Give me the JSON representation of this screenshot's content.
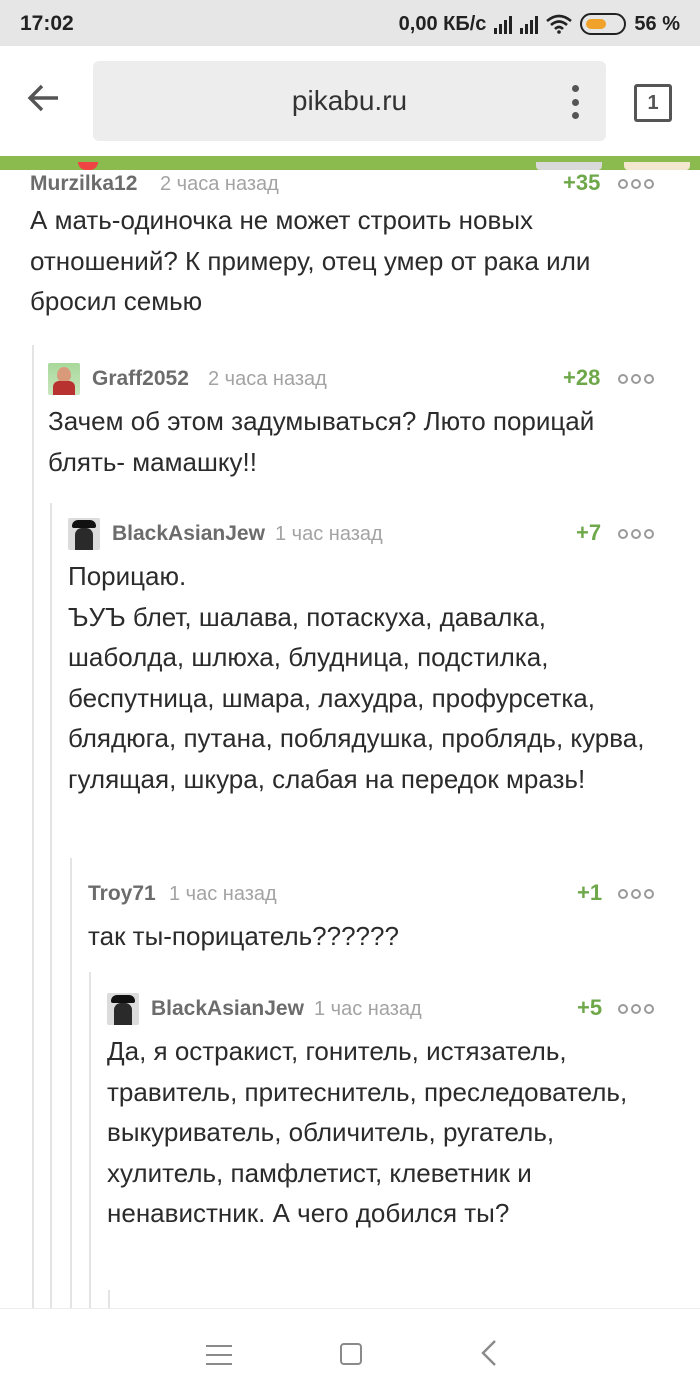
{
  "status_bar": {
    "time": "17:02",
    "network_speed": "0,00 КБ/с",
    "battery_percent": "56 %",
    "icons": [
      "signal-icon",
      "signal-icon",
      "wifi-icon",
      "battery-icon"
    ]
  },
  "browser": {
    "url": "pikabu.ru",
    "tab_count": "1",
    "icons": [
      "back-arrow-icon",
      "overflow-menu-icon",
      "tabs-icon"
    ]
  },
  "comments": [
    {
      "author": "Murzilka12",
      "time": "2 часа назад",
      "rating": "+35",
      "avatar": false,
      "text": "А мать-одиночка не может строить новых отношений? К примеру, отец умер от рака или бросил семью"
    },
    {
      "author": "Graff2052",
      "time": "2 часа назад",
      "rating": "+28",
      "avatar": true,
      "text": "Зачем об этом задумываться? Люто порицай блять- мамашку!!"
    },
    {
      "author": "BlackAsianJew",
      "time": "1 час назад",
      "rating": "+7",
      "avatar": true,
      "text_line1": "Порицаю.",
      "text_rest": "ЪУЪ блет, шалава, потаскуха, давалка, шаболда, шлюха, блудница, подстилка, беспутница, шмара, лахудра, профурсетка, блядюга, путана, поблядушка, проблядь, курва, гулящая, шкура, слабая на передок мразь!"
    },
    {
      "author": "Troy71",
      "time": "1 час назад",
      "rating": "+1",
      "avatar": false,
      "text": "так ты-порицатель??????"
    },
    {
      "author": "BlackAsianJew",
      "time": "1 час назад",
      "rating": "+5",
      "avatar": true,
      "text": "Да, я остракист, гонитель, истязатель, травитель, притеснитель, преследователь, выкуриватель, обличитель, ругатель, хулитель, памфлетист, клеветник и ненавистник. А чего добился ты?"
    }
  ],
  "nav_bar": {
    "icons": [
      "menu-icon",
      "home-icon",
      "back-icon"
    ]
  }
}
